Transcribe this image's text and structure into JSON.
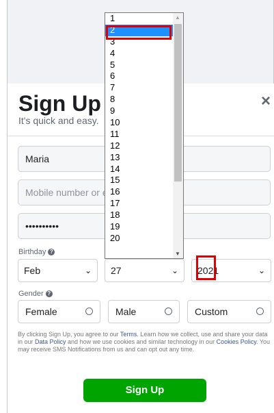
{
  "header": {
    "title": "Sign Up",
    "subtitle": "It's quick and easy.",
    "close_icon": "×"
  },
  "form": {
    "first_name_value": "Maria",
    "mobile_placeholder": "Mobile number or e",
    "password_value": "••••••••••",
    "birthday_label": "Birthday",
    "birth_month": "Feb",
    "birth_day": "27",
    "birth_year": "2021",
    "gender_label": "Gender",
    "gender_options": [
      "Female",
      "Male",
      "Custom"
    ],
    "help_icon": "?"
  },
  "dropdown": {
    "items": [
      "1",
      "2",
      "3",
      "4",
      "5",
      "6",
      "7",
      "8",
      "9",
      "10",
      "11",
      "12",
      "13",
      "14",
      "15",
      "16",
      "17",
      "18",
      "19",
      "20"
    ],
    "selected": "2"
  },
  "terms": {
    "text_1": "By clicking Sign Up, you agree to our ",
    "terms_link": "Terms",
    "text_2": ". Learn how we collect, use and share your data in our ",
    "data_policy_link": "Data Policy",
    "text_3": " and how we use cookies and similar technology in our ",
    "cookies_link": "Cookies Policy",
    "text_4": ". You may receive SMS Notifications from us and can opt out any time."
  },
  "submit": {
    "label": "Sign Up"
  },
  "colors": {
    "accent_green": "#00a400",
    "selection_blue": "#1e90ff",
    "highlight_red": "#e00000"
  }
}
